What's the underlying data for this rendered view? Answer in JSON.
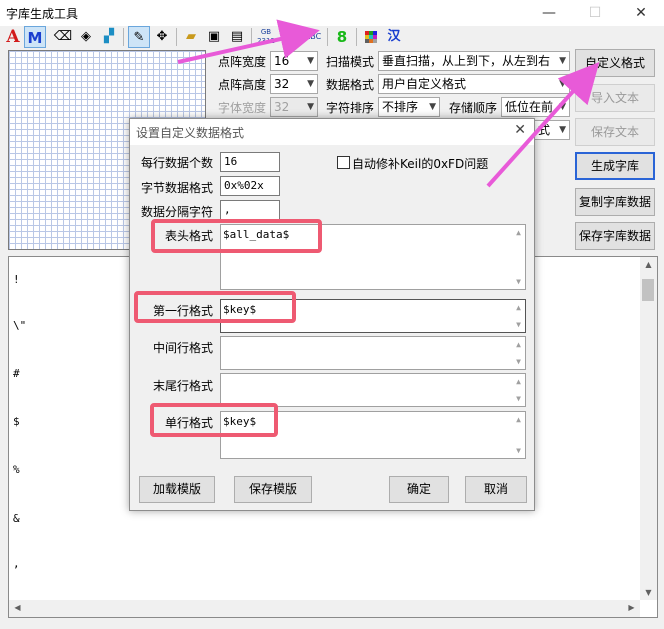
{
  "window": {
    "title": "字库生成工具"
  },
  "toolbar": {
    "icon_a": "A",
    "icon_m": "M",
    "gb_top": "GB",
    "gb_bottom": "2312",
    "gbk": "GBK",
    "abc": "ABC",
    "eight": "8",
    "han": "汉"
  },
  "settings": {
    "dot_width_label": "点阵宽度",
    "dot_width_value": "16",
    "dot_height_label": "点阵高度",
    "dot_height_value": "32",
    "font_width_label": "字体宽度",
    "font_width_value": "32",
    "scan_mode_label": "扫描模式",
    "scan_mode_value": "垂直扫描，从上到下，从左到右",
    "data_format_label": "数据格式",
    "data_format_value": "用户自定义格式",
    "char_sort_label": "字符排序",
    "char_sort_value": "不排序",
    "store_order_label": "存储顺序",
    "store_order_value": "低位在前",
    "hidden_combo_value": "式"
  },
  "buttons": {
    "custom_format": "自定义格式",
    "import_text": "导入文本",
    "save_text": "保存文本",
    "generate": "生成字库",
    "copy_data": "复制字库数据",
    "save_data": "保存字库数据"
  },
  "output": {
    "lines": [
      "!",
      "\\\"",
      "#",
      "$",
      "%",
      "&",
      ","
    ]
  },
  "dialog": {
    "title": "设置自定义数据格式",
    "per_row_label": "每行数据个数",
    "per_row_value": "16",
    "byte_format_label": "字节数据格式",
    "byte_format_value": "0x%02x",
    "separator_label": "数据分隔字符",
    "separator_value": ",",
    "keil_fix_label": "自动修补Keil的0xFD问题",
    "header_label": "表头格式",
    "header_value": "$all_data$",
    "first_row_label": "第一行格式",
    "first_row_value": "$key$",
    "middle_row_label": "中间行格式",
    "middle_row_value": "",
    "last_row_label": "末尾行格式",
    "last_row_value": "",
    "single_row_label": "单行格式",
    "single_row_value": "$key$",
    "load_template": "加载模版",
    "save_template": "保存模版",
    "ok": "确定",
    "cancel": "取消"
  },
  "colors": {
    "highlight": "#ee5a72",
    "arrow": "#e85ad8"
  }
}
